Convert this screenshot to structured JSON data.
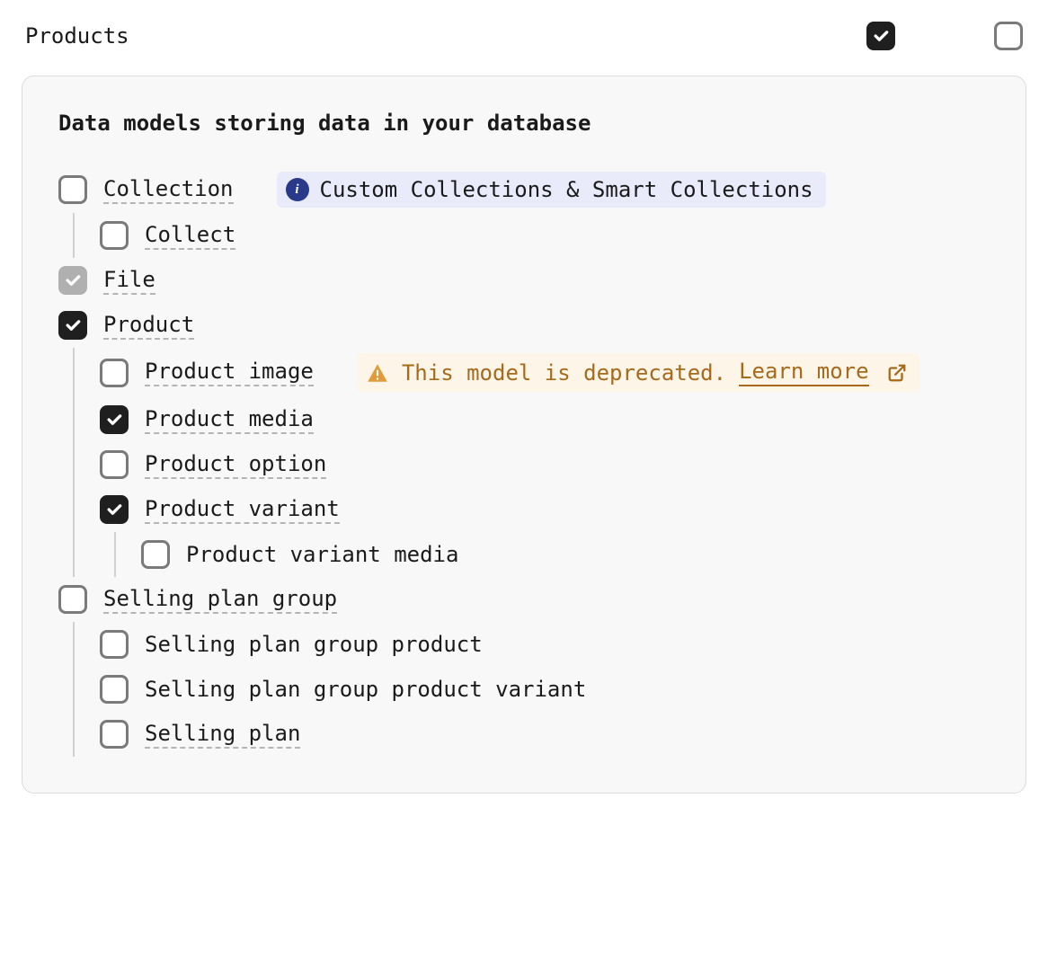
{
  "header": {
    "title": "Products",
    "check1": "checked",
    "check2": "unchecked"
  },
  "panel": {
    "title": "Data models storing data in your database"
  },
  "collection": {
    "label": "Collection",
    "state": "unchecked",
    "info": "Custom Collections & Smart Collections",
    "children": [
      {
        "label": "Collect",
        "state": "unchecked",
        "dotted": true
      }
    ]
  },
  "file": {
    "label": "File",
    "state": "checked-disabled"
  },
  "product": {
    "label": "Product",
    "state": "checked",
    "children": [
      {
        "label": "Product image",
        "state": "unchecked",
        "dotted": true,
        "warn": {
          "text": "This model is deprecated.",
          "link": "Learn more"
        }
      },
      {
        "label": "Product media",
        "state": "checked",
        "dotted": true
      },
      {
        "label": "Product option",
        "state": "unchecked",
        "dotted": true
      },
      {
        "label": "Product variant",
        "state": "checked",
        "dotted": true,
        "children": [
          {
            "label": "Product variant media",
            "state": "unchecked",
            "dotted": false
          }
        ]
      }
    ]
  },
  "sellingPlanGroup": {
    "label": "Selling plan group",
    "state": "unchecked",
    "children": [
      {
        "label": "Selling plan group product",
        "state": "unchecked",
        "dotted": false
      },
      {
        "label": "Selling plan group product variant",
        "state": "unchecked",
        "dotted": false
      },
      {
        "label": "Selling plan",
        "state": "unchecked",
        "dotted": true
      }
    ]
  }
}
